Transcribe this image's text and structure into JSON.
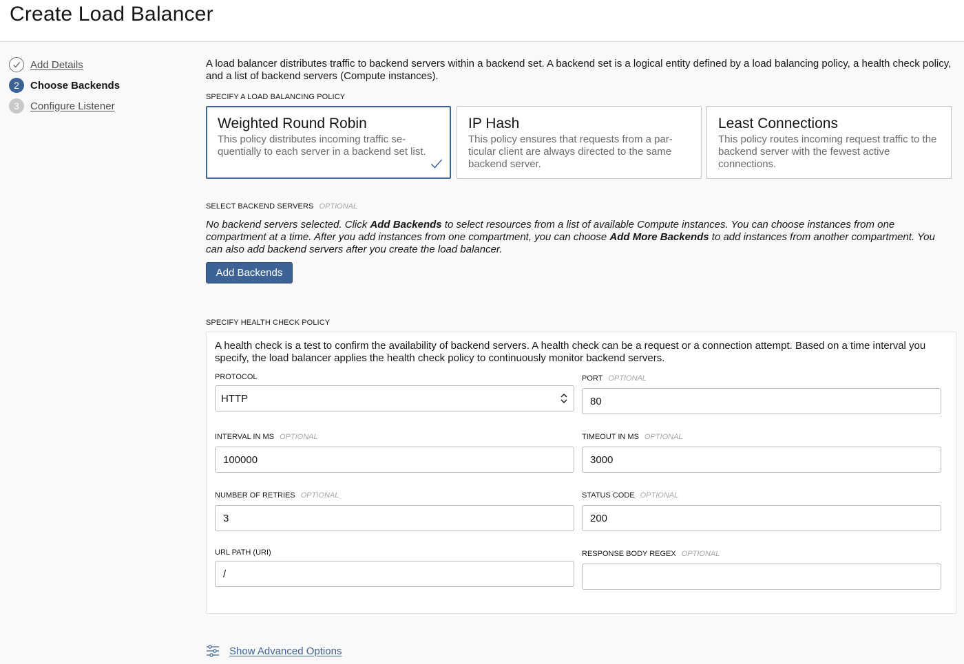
{
  "page": {
    "title": "Create Load Balancer"
  },
  "steps": [
    {
      "number": "1",
      "label": "Add Details",
      "state": "done",
      "icon": "check-icon"
    },
    {
      "number": "2",
      "label": "Choose Backends",
      "state": "active"
    },
    {
      "number": "3",
      "label": "Configure Listener",
      "state": "todo"
    }
  ],
  "intro": "A load balancer distributes traffic to backend servers within a backend set. A backend set is a logical entity defined by a load balancing policy, a health check policy, and a list of backend servers (Compute instances).",
  "policy_section": {
    "label": "SPECIFY A LOAD BALANCING POLICY",
    "options": [
      {
        "title": "Weighted Round Robin",
        "description": "This policy distributes incoming traffic se-quentially to each server in a backend set list.",
        "selected": true
      },
      {
        "title": "IP Hash",
        "description": "This policy ensures that requests from a par-ticular client are always directed to the same backend server.",
        "selected": false
      },
      {
        "title": "Least Connections",
        "description": "This policy routes incoming request traffic to the backend server with the fewest active connections.",
        "selected": false
      }
    ]
  },
  "backend_section": {
    "label": "SELECT BACKEND SERVERS",
    "optional": "OPTIONAL",
    "text_1": "No backend servers selected. Click ",
    "bold_1": "Add Backends",
    "text_2": " to select resources from a list of available Compute instances. You can choose instances from one compartment at a time. After you add instances from one compartment, you can choose ",
    "bold_2": "Add More Backends",
    "text_3": " to add instances from another compartment. You can also add backend servers after you create the load balancer.",
    "button": "Add Backends"
  },
  "health_check": {
    "label": "SPECIFY HEALTH CHECK POLICY",
    "intro": "A health check is a test to confirm the availability of backend servers. A health check can be a request or a connection attempt. Based on a time interval you specify, the load balancer applies the health check policy to continuously monitor backend servers.",
    "protocol": {
      "label": "PROTOCOL",
      "value": "HTTP"
    },
    "port": {
      "label": "PORT",
      "optional": "OPTIONAL",
      "value": "80"
    },
    "interval": {
      "label": "INTERVAL IN MS",
      "optional": "OPTIONAL",
      "value": "100000"
    },
    "timeout": {
      "label": "TIMEOUT IN MS",
      "optional": "OPTIONAL",
      "value": "3000"
    },
    "retries": {
      "label": "NUMBER OF RETRIES",
      "optional": "OPTIONAL",
      "value": "3"
    },
    "status_code": {
      "label": "STATUS CODE",
      "optional": "OPTIONAL",
      "value": "200"
    },
    "url_path": {
      "label": "URL PATH (URI)",
      "value": "/"
    },
    "response_regex": {
      "label": "RESPONSE BODY REGEX",
      "optional": "OPTIONAL",
      "value": ""
    }
  },
  "advanced": {
    "label": "Show Advanced Options",
    "icon": "sliders-icon"
  },
  "colors": {
    "accent": "#3d6296",
    "border": "#c7c7c7",
    "muted_text": "#6b6b6b",
    "optional_text": "#a5a5a5"
  }
}
